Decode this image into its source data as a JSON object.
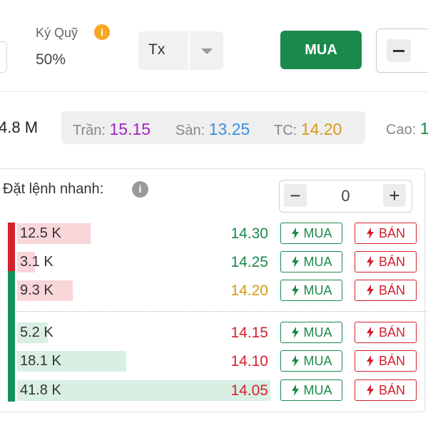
{
  "top": {
    "margin_label": "Ký Quỹ",
    "margin_value": "50%",
    "info_glyph": "i",
    "account_type": {
      "selected": "Tx"
    },
    "buy_button_label": "MUA",
    "stepper_minus": "–"
  },
  "price_bar": {
    "volume_text": "4.8 M",
    "ceiling": {
      "label": "Trần:",
      "value": "15.15",
      "color": "#a321c8"
    },
    "floor": {
      "label": "Sàn:",
      "value": "13.25",
      "color": "#3a8fe0"
    },
    "reference": {
      "label": "TC:",
      "value": "14.20",
      "color": "#d49a19"
    },
    "high": {
      "label": "Cao:",
      "value": "1",
      "color": "#1a8a4a"
    }
  },
  "quick_order": {
    "title": "Đặt lệnh nhanh:",
    "info_glyph": "i",
    "quantity": {
      "minus": "−",
      "value": "0",
      "plus": "+"
    },
    "buy_label": "MUA",
    "sell_label": "BÁN",
    "colors": {
      "up": "#1a8a4a",
      "down": "#d4202f",
      "reference": "#d49a19"
    },
    "ask_rows": [
      {
        "volume": "12.5 K",
        "volume_fraction": 0.29,
        "price": "14.30",
        "price_color": "#1a8a4a"
      },
      {
        "volume": "3.1 K",
        "volume_fraction": 0.07,
        "price": "14.25",
        "price_color": "#1a8a4a"
      },
      {
        "volume": "9.3 K",
        "volume_fraction": 0.22,
        "price": "14.20",
        "price_color": "#d49a19"
      }
    ],
    "bid_rows": [
      {
        "volume": "5.2 K",
        "volume_fraction": 0.12,
        "price": "14.15",
        "price_color": "#d4202f"
      },
      {
        "volume": "18.1 K",
        "volume_fraction": 0.43,
        "price": "14.10",
        "price_color": "#d4202f"
      },
      {
        "volume": "41.8 K",
        "volume_fraction": 1.0,
        "price": "14.05",
        "price_color": "#d4202f"
      }
    ]
  }
}
